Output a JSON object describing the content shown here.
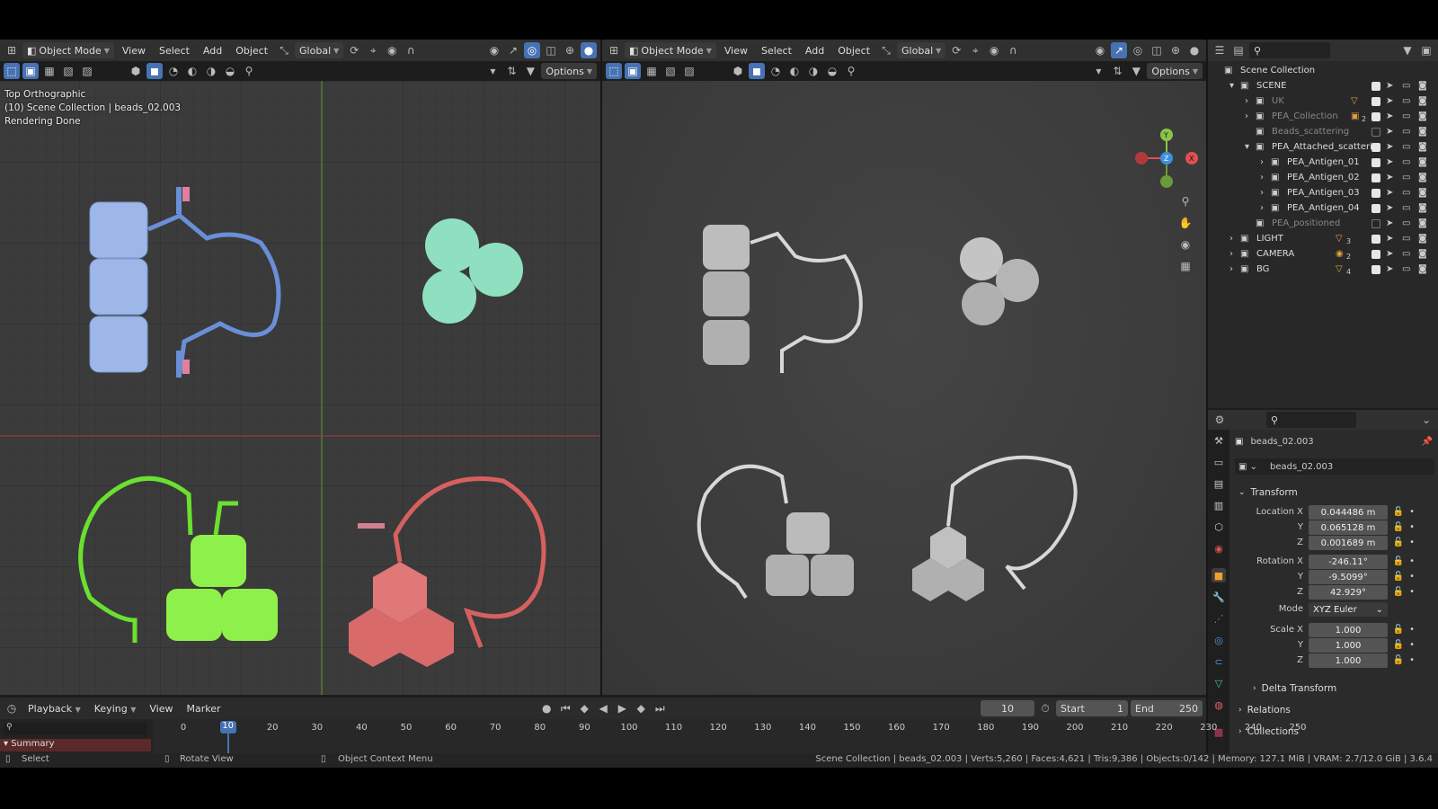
{
  "viewport_left": {
    "header": {
      "mode": "Object Mode",
      "menus": [
        "View",
        "Select",
        "Add",
        "Object"
      ],
      "orientation": "Global",
      "options": "Options"
    },
    "overlay": {
      "view_name": "Top Orthographic",
      "collection_info": "(10) Scene Collection | beads_02.003",
      "render_status": "Rendering Done"
    }
  },
  "viewport_right": {
    "header": {
      "mode": "Object Mode",
      "menus": [
        "View",
        "Select",
        "Add",
        "Object"
      ],
      "orientation": "Global",
      "options": "Options"
    },
    "gizmo": {
      "y": "Y",
      "z": "Z",
      "x": "X"
    }
  },
  "outliner": {
    "root": "Scene Collection",
    "rows": [
      {
        "label": "SCENE",
        "badge": ""
      },
      {
        "label": "UK",
        "badge": ""
      },
      {
        "label": "PEA_Collection",
        "badge": "2"
      },
      {
        "label": "Beads_scattering",
        "badge": ""
      },
      {
        "label": "PEA_Attached_scatterin",
        "badge": ""
      },
      {
        "label": "PEA_Antigen_01",
        "badge": ""
      },
      {
        "label": "PEA_Antigen_02",
        "badge": ""
      },
      {
        "label": "PEA_Antigen_03",
        "badge": ""
      },
      {
        "label": "PEA_Antigen_04",
        "badge": ""
      },
      {
        "label": "PEA_positioned",
        "badge": ""
      },
      {
        "label": "LIGHT",
        "badge": "3"
      },
      {
        "label": "CAMERA",
        "badge": "2"
      },
      {
        "label": "BG",
        "badge": "4"
      }
    ]
  },
  "properties": {
    "object_name": "beads_02.003",
    "data_name": "beads_02.003",
    "transform_title": "Transform",
    "location_label": "Location X",
    "location": [
      "0.044486 m",
      "0.065128 m",
      "0.001689 m"
    ],
    "rotation_label": "Rotation X",
    "rotation": [
      "-246.11°",
      "-9.5099°",
      "42.929°"
    ],
    "mode_label": "Mode",
    "mode_value": "XYZ Euler",
    "scale_label": "Scale X",
    "scale": [
      "1.000",
      "1.000",
      "1.000"
    ],
    "axis_y": "Y",
    "axis_z": "Z",
    "delta": "Delta Transform",
    "relations": "Relations",
    "collections": "Collections"
  },
  "timeline": {
    "menus": [
      "Playback",
      "Keying",
      "View",
      "Marker"
    ],
    "current_frame": "10",
    "start_label": "Start",
    "start": "1",
    "end_label": "End",
    "end": "250",
    "summary": "Summary",
    "ticks": [
      "0",
      "10",
      "20",
      "30",
      "40",
      "50",
      "60",
      "70",
      "80",
      "90",
      "100",
      "110",
      "120",
      "130",
      "140",
      "150",
      "160",
      "170",
      "180",
      "190",
      "200",
      "210",
      "220",
      "230",
      "240",
      "250"
    ]
  },
  "statusbar": {
    "select": "Select",
    "rotate": "Rotate View",
    "context": "Object Context Menu",
    "info": "Scene Collection | beads_02.003 | Verts:5,260 | Faces:4,621 | Tris:9,386 | Objects:0/142 | Memory: 127.1 MiB | VRAM: 2.7/12.0 GiB | 3.6.4"
  },
  "colors": {
    "accent": "#4772b3",
    "blue_model": "#9db8e8",
    "teal_model": "#8fe0c0",
    "green_model": "#8ef04a",
    "red_model": "#e07878",
    "gray_model": "#b8b8b8",
    "timeline_active": "#4772b3",
    "summary_bar": "#5a2a2a"
  }
}
